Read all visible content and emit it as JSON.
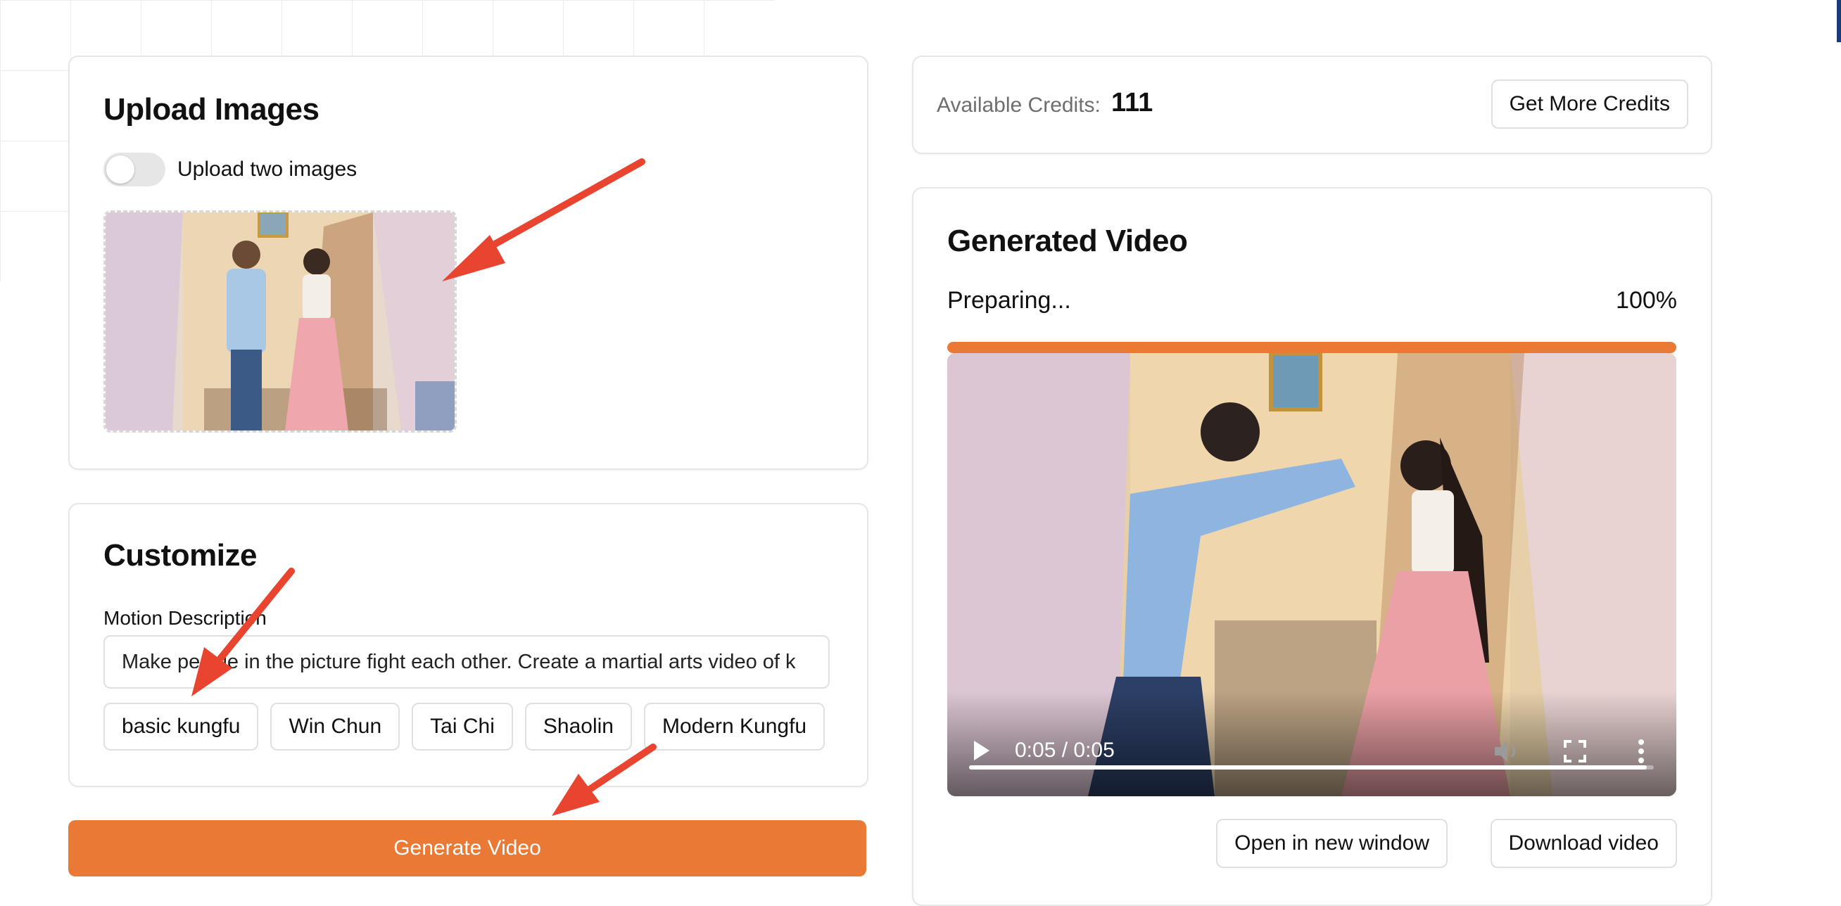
{
  "upload": {
    "title": "Upload Images",
    "toggle_label": "Upload two images",
    "toggle_on": false
  },
  "customize": {
    "title": "Customize",
    "motion_label": "Motion Description",
    "motion_value": "Make people in the picture fight each other. Create a martial arts video of k",
    "styles": [
      "basic kungfu",
      "Win Chun",
      "Tai Chi",
      "Shaolin",
      "Modern Kungfu"
    ]
  },
  "generate_label": "Generate Video",
  "credits": {
    "label": "Available Credits:",
    "value": "111",
    "button": "Get More Credits"
  },
  "video": {
    "title": "Generated Video",
    "status": "Preparing...",
    "percent_text": "100%",
    "progress": 1.0,
    "time": "0:05 / 0:05",
    "seek_fraction": 0.99,
    "open_label": "Open in new window",
    "download_label": "Download video"
  },
  "colors": {
    "accent": "#e97935",
    "annotation_arrow": "#e8442f"
  }
}
